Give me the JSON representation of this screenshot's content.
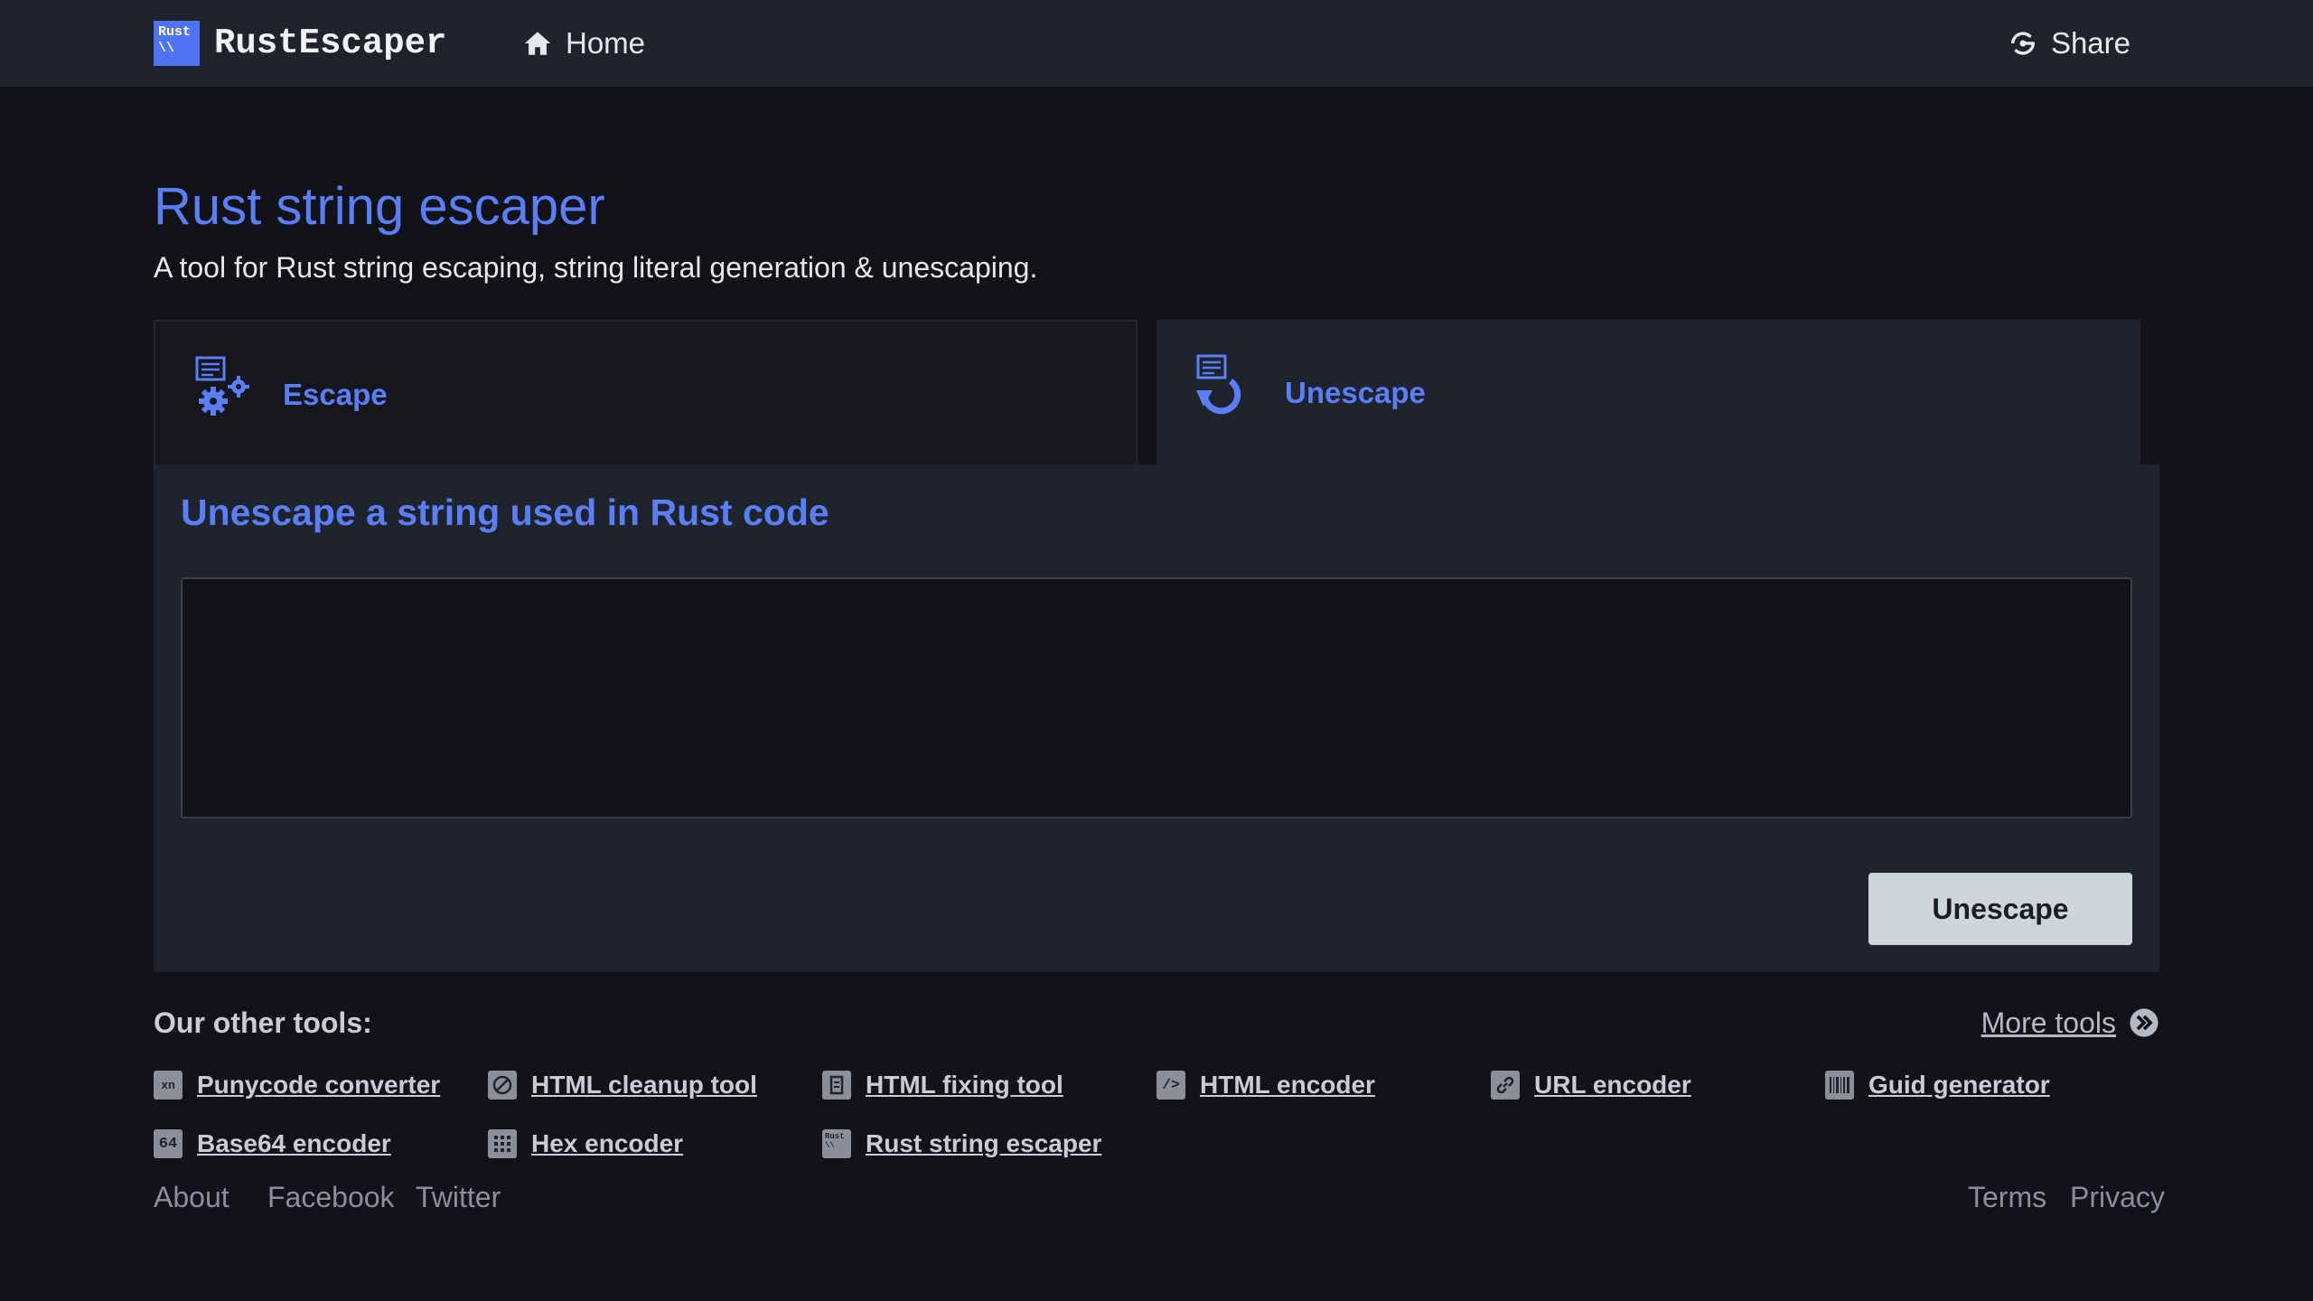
{
  "header": {
    "logo_box_text": "Rust\n\\\\",
    "brand": "RustEscaper",
    "home_label": "Home",
    "share_label": "Share"
  },
  "page": {
    "title": "Rust string escaper",
    "subtitle": "A tool for Rust string escaping, string literal generation & unescaping."
  },
  "tabs": [
    {
      "label": "Escape",
      "icon": "escape-gears-icon",
      "active": false
    },
    {
      "label": "Unescape",
      "icon": "unescape-arrow-icon",
      "active": true
    }
  ],
  "panel": {
    "title": "Unescape a string used in Rust code",
    "input_value": "",
    "input_placeholder": "",
    "button_label": "Unescape"
  },
  "other_tools": {
    "heading": "Our other tools:",
    "more_label": "More tools",
    "items": [
      {
        "label": "Punycode converter",
        "icon": "xn"
      },
      {
        "label": "HTML cleanup tool",
        "icon": "cleanup"
      },
      {
        "label": "HTML fixing tool",
        "icon": "fix"
      },
      {
        "label": "HTML encoder",
        "icon": "/>"
      },
      {
        "label": "URL encoder",
        "icon": "link"
      },
      {
        "label": "Guid generator",
        "icon": "barcode"
      },
      {
        "label": "Base64 encoder",
        "icon": "64"
      },
      {
        "label": "Hex encoder",
        "icon": "hex"
      },
      {
        "label": "Rust string escaper",
        "icon": "rust"
      }
    ]
  },
  "footer": {
    "left": [
      "About",
      "Facebook",
      "Twitter"
    ],
    "right": [
      "Terms",
      "Privacy"
    ]
  },
  "colors": {
    "accent": "#5a7ef6",
    "background": "#111318",
    "surface": "#1f232b",
    "button_bg": "#cdd6d8"
  }
}
